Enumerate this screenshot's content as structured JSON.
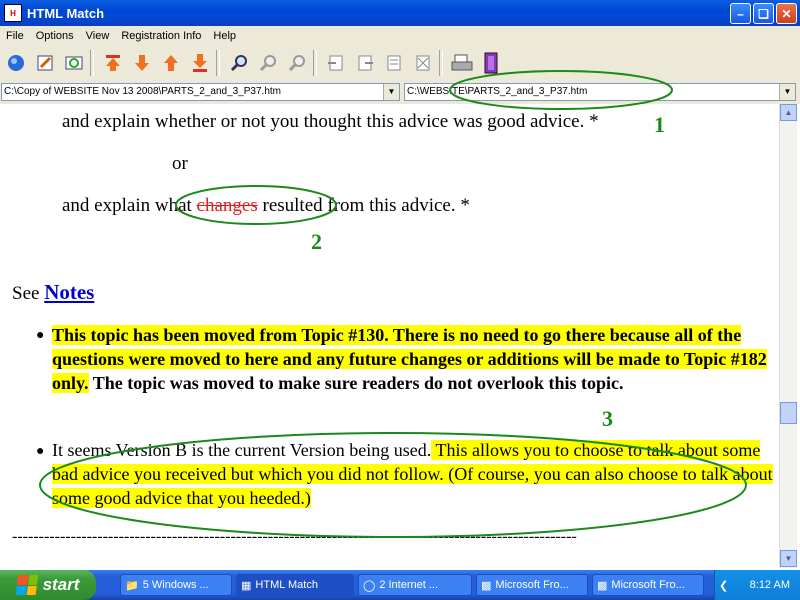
{
  "window": {
    "title": "HTML Match"
  },
  "menu": [
    "File",
    "Options",
    "View",
    "Registration Info",
    "Help"
  ],
  "paths": {
    "left": "C:\\Copy of WEBSITE Nov 13 2008\\PARTS_2_and_3_P37.htm",
    "right": "C:\\WEBSITE\\PARTS_2_and_3_P37.htm"
  },
  "content": {
    "line1": "and explain whether or not you thought this advice was good advice. *",
    "or": "or",
    "line3_pre": "and explain what ",
    "line3_strike": "changes",
    "line3_post": " resulted from this advice. *",
    "see": "See ",
    "notes": "Notes",
    "bullet1_highlight": "This topic has been moved from Topic #130. There is no need to go there because all of the questions were moved to here and any future changes or additions will be made to Topic #182 only.",
    "bullet1_rest": " The topic was moved to make sure readers do not overlook this topic.",
    "bullet2_plain": "It seems Version B is the current Version being used.",
    "bullet2_highlight": " This allows you to choose to talk about some bad advice you received but which you did not follow. (Of course, you can also choose to talk about some good advice that you heeded.)",
    "dashes": "----------------------------------------------------------------------------------------------------------",
    "annotations": [
      "1",
      "2",
      "3"
    ]
  },
  "taskbar": {
    "start": "start",
    "tasks": [
      "5 Windows ...",
      "HTML Match",
      "2 Internet ...",
      "Microsoft Fro...",
      "Microsoft Fro..."
    ],
    "clock": "8:12 AM"
  },
  "colors": {
    "annotation": "#1a8a1a",
    "highlight": "#ffff00",
    "strike": "#e02020",
    "link": "#0000cc"
  }
}
